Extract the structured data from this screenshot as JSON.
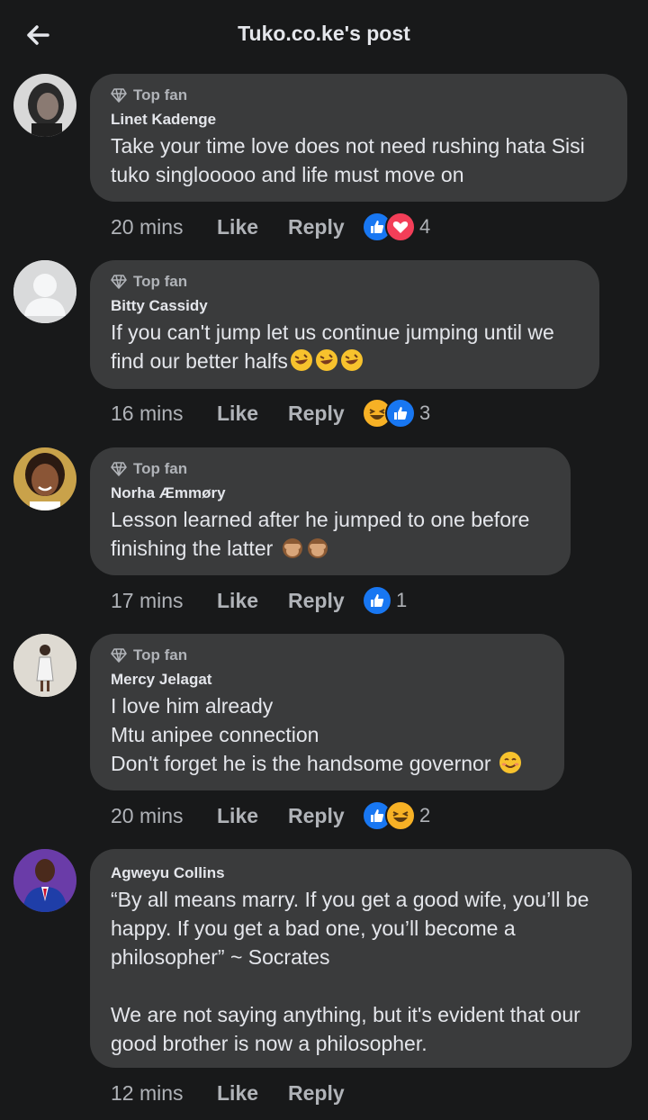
{
  "header": {
    "title": "Tuko.co.ke's post",
    "back_icon": "arrow-left-icon"
  },
  "topfan_label": "Top fan",
  "actions": {
    "like": "Like",
    "reply": "Reply"
  },
  "comments": [
    {
      "author": "Linet Kadenge",
      "top_fan": true,
      "text": "Take your time love does not need rushing hata Sisi\ntuko singlooooo and life must move on",
      "time": "20 mins",
      "reactions": [
        "like",
        "love"
      ],
      "reaction_count": "4"
    },
    {
      "author": "Bitty Cassidy",
      "top_fan": true,
      "text": "If you can't jump let us continue jumping until we\nfind our better halfs",
      "trailing_emoji": [
        "rofl-emoji",
        "rofl-emoji",
        "rofl-emoji"
      ],
      "time": "16 mins",
      "reactions": [
        "haha",
        "like"
      ],
      "reaction_count": "3"
    },
    {
      "author": "Norha Æmmøry",
      "top_fan": true,
      "text": "Lesson learned after he jumped to one before\nfinishing the latter ",
      "trailing_emoji": [
        "see-no-evil-monkey-emoji",
        "see-no-evil-monkey-emoji"
      ],
      "time": "17 mins",
      "reactions": [
        "like"
      ],
      "reaction_count": "1"
    },
    {
      "author": "Mercy Jelagat",
      "top_fan": true,
      "text": "I love him already\nMtu anipee connection\nDon't forget he is the handsome governor ",
      "trailing_emoji": [
        "smiling-face-emoji"
      ],
      "time": "20 mins",
      "reactions": [
        "like",
        "haha"
      ],
      "reaction_count": "2"
    },
    {
      "author": "Agweyu Collins",
      "top_fan": false,
      "text": "“By all means marry. If you get a good wife, you’ll be\nhappy. If you get a bad one, you’ll become a\nphilosopher” ~ Socrates\n\nWe are not saying anything, but it's evident that our\ngood brother is now a philosopher.",
      "time": "12 mins",
      "reactions": [],
      "reaction_count": ""
    }
  ]
}
